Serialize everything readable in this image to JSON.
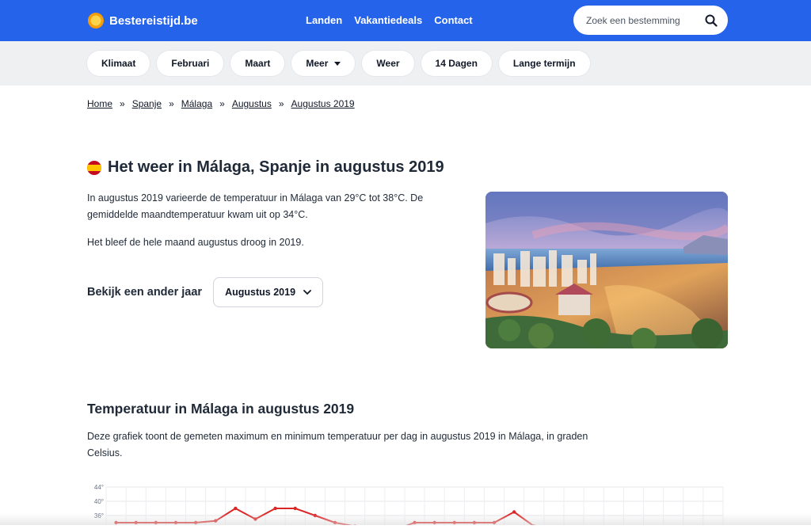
{
  "header": {
    "logo_text": "Bestereistijd.be",
    "nav": [
      {
        "label": "Landen"
      },
      {
        "label": "Vakantiedeals"
      },
      {
        "label": "Contact"
      }
    ],
    "search": {
      "placeholder": "Zoek een bestemming",
      "value": ""
    }
  },
  "subnav": {
    "pills": [
      {
        "label": "Klimaat"
      },
      {
        "label": "Februari"
      },
      {
        "label": "Maart"
      },
      {
        "label": "Meer"
      },
      {
        "label": "Weer"
      },
      {
        "label": "14 Dagen"
      },
      {
        "label": "Lange termijn"
      }
    ]
  },
  "breadcrumb": {
    "items": [
      "Home",
      "Spanje",
      "Málaga",
      "Augustus",
      "Augustus 2019"
    ],
    "separator": "»"
  },
  "page": {
    "title": "Het weer in Málaga, Spanje in augustus 2019",
    "intro_1": "In augustus 2019 varieerde de temperatuur in Málaga van 29°C tot 38°C. De gemiddelde maandtemperatuur kwam uit op 34°C.",
    "intro_2": "Het bleef de hele maand augustus droog in 2019.",
    "year_label": "Bekijk een ander jaar",
    "year_select": "Augustus 2019",
    "chart_title": "Temperatuur in Málaga in augustus 2019",
    "chart_desc": "Deze grafiek toont de gemeten maximum en minimum temperatuur per dag in augustus 2019 in Málaga, in graden Celsius."
  },
  "colors": {
    "brand_blue": "#2563eb",
    "max_line": "#dc2626"
  },
  "chart_data": {
    "type": "line",
    "y_ticks": [
      "44°",
      "40°",
      "36°"
    ],
    "ylim": [
      32,
      44
    ],
    "x": [
      1,
      2,
      3,
      4,
      5,
      6,
      7,
      8,
      9,
      10,
      11,
      12,
      13,
      14,
      15,
      16,
      17,
      18,
      19,
      20,
      21,
      22,
      23,
      24,
      25,
      26,
      27,
      28,
      29,
      30,
      31
    ],
    "series": [
      {
        "values": [
          34,
          34,
          34,
          34,
          34,
          34.5,
          38,
          35,
          38,
          38,
          36,
          34,
          33,
          32,
          32,
          34,
          34,
          34,
          34,
          34,
          37,
          33,
          32,
          32,
          32,
          32,
          32,
          32,
          32,
          32,
          32
        ]
      }
    ],
    "grid": true
  }
}
